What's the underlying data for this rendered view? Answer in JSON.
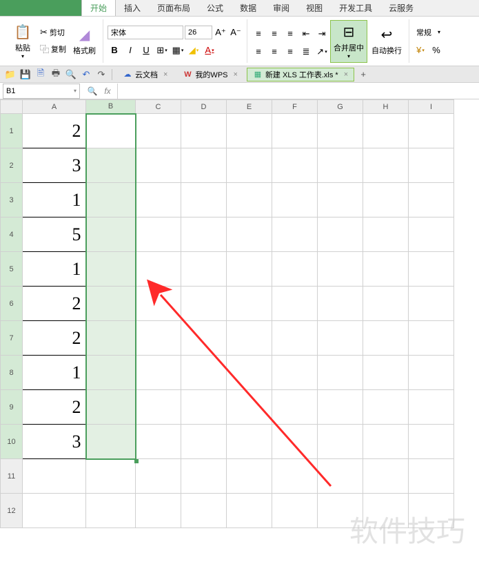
{
  "app": {
    "name": "WPS 表格"
  },
  "menus": {
    "items": [
      "开始",
      "插入",
      "页面布局",
      "公式",
      "数据",
      "审阅",
      "视图",
      "开发工具",
      "云服务"
    ],
    "active": 0
  },
  "ribbon": {
    "clipboard": {
      "paste": "粘贴",
      "cut": "剪切",
      "copy": "复制",
      "format_painter": "格式刷"
    },
    "font": {
      "name": "宋体",
      "size": "26",
      "bold": "B",
      "italic": "I",
      "underline": "U"
    },
    "alignment": {
      "merge_center": "合并居中",
      "wrap_text": "自动换行"
    },
    "style": {
      "normal": "常规"
    }
  },
  "doc_tabs": {
    "cloud": "云文档",
    "wps": "我的WPS",
    "active": "新建 XLS 工作表.xls *"
  },
  "name_box": {
    "value": "B1"
  },
  "formula_bar": {
    "fx": "fx",
    "value": ""
  },
  "columns": [
    "A",
    "B",
    "C",
    "D",
    "E",
    "F",
    "G",
    "H",
    "I"
  ],
  "grid": {
    "rows": [
      {
        "n": "1",
        "a": "2"
      },
      {
        "n": "2",
        "a": "3"
      },
      {
        "n": "3",
        "a": "1"
      },
      {
        "n": "4",
        "a": "5"
      },
      {
        "n": "5",
        "a": "1"
      },
      {
        "n": "6",
        "a": "2"
      },
      {
        "n": "7",
        "a": "2"
      },
      {
        "n": "8",
        "a": "1"
      },
      {
        "n": "9",
        "a": "2"
      },
      {
        "n": "10",
        "a": "3"
      }
    ],
    "empty_rows": [
      "11",
      "12"
    ]
  },
  "selection": {
    "col": "B",
    "from_row": 1,
    "to_row": 10,
    "active": "B1"
  },
  "watermark": "软件技巧",
  "chart_data": {
    "type": "table",
    "columns": [
      "A"
    ],
    "values": [
      2,
      3,
      1,
      5,
      1,
      2,
      2,
      1,
      2,
      3
    ]
  }
}
